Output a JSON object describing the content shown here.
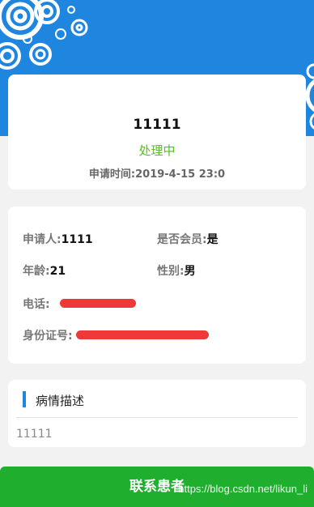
{
  "status_card": {
    "order_id": "11111",
    "status": "处理中",
    "time_label": "申请时间:",
    "time_value": "2019-4-15 23:0"
  },
  "info": {
    "applicant_label": "申请人:",
    "applicant_value": "1111",
    "member_label": "是否会员:",
    "member_value": "是",
    "age_label": "年龄:",
    "age_value": "21",
    "gender_label": "性别:",
    "gender_value": "男",
    "phone_label": "电话:",
    "id_label": "身份证号:"
  },
  "description": {
    "title": "病情描述",
    "text": "11111"
  },
  "contact_button": "联系患者",
  "watermark": "https://blog.csdn.net/likun_li",
  "colors": {
    "banner": "#1f86e0",
    "status": "#52c41a",
    "button": "#1fae2e",
    "redaction": "#f03838"
  }
}
